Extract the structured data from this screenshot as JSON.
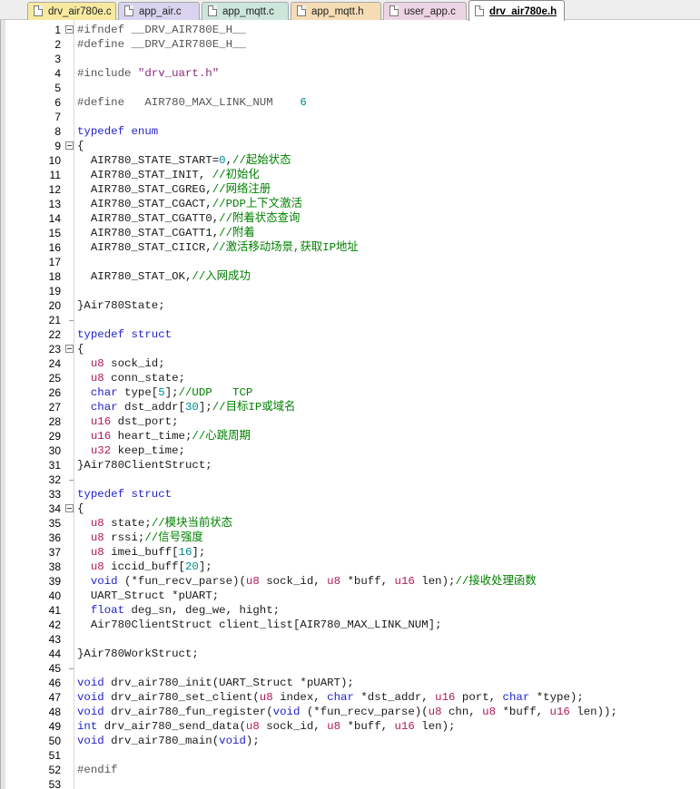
{
  "tabs": [
    {
      "label": "drv_air780e.c",
      "bg": "#f7eaa0",
      "active": false
    },
    {
      "label": "app_air.c",
      "bg": "#d9d3f0",
      "active": false
    },
    {
      "label": "app_mqtt.c",
      "bg": "#cde6dc",
      "active": false
    },
    {
      "label": "app_mqtt.h",
      "bg": "#f5dcb4",
      "active": false
    },
    {
      "label": "user_app.c",
      "bg": "#ecd4e4",
      "active": false
    },
    {
      "label": "drv_air780e.h",
      "bg": "#ffffff",
      "active": true
    }
  ],
  "editor": {
    "colors": {
      "keyword": "#2222cc",
      "type": "#b01a5a",
      "comment": "#008000",
      "string": "#8a2a7a",
      "number": "#008a8a",
      "preprocessor": "#555555"
    },
    "lines": [
      {
        "n": "1",
        "fold": "open",
        "tokens": [
          [
            "pp",
            "#ifndef __DRV_AIR780E_H__"
          ]
        ]
      },
      {
        "n": "2",
        "fold": "",
        "tokens": [
          [
            "pp",
            "#define __DRV_AIR780E_H__"
          ]
        ]
      },
      {
        "n": "3",
        "fold": "",
        "tokens": []
      },
      {
        "n": "4",
        "fold": "",
        "tokens": [
          [
            "pp",
            "#include "
          ],
          [
            "str",
            "\"drv_uart.h\""
          ]
        ]
      },
      {
        "n": "5",
        "fold": "",
        "tokens": []
      },
      {
        "n": "6",
        "fold": "",
        "tokens": [
          [
            "pp",
            "#define   AIR780_MAX_LINK_NUM    "
          ],
          [
            "num",
            "6"
          ]
        ]
      },
      {
        "n": "7",
        "fold": "",
        "tokens": []
      },
      {
        "n": "8",
        "fold": "",
        "tokens": [
          [
            "kw",
            "typedef enum"
          ]
        ]
      },
      {
        "n": "9",
        "fold": "open",
        "tokens": [
          [
            "pl",
            "{"
          ]
        ]
      },
      {
        "n": "10",
        "fold": "",
        "tokens": [
          [
            "pl",
            "  AIR780_STATE_START="
          ],
          [
            "num",
            "0"
          ],
          [
            "pl",
            ","
          ],
          [
            "cm",
            "//起始状态"
          ]
        ]
      },
      {
        "n": "11",
        "fold": "",
        "tokens": [
          [
            "pl",
            "  AIR780_STAT_INIT, "
          ],
          [
            "cm",
            "//初始化"
          ]
        ]
      },
      {
        "n": "12",
        "fold": "",
        "tokens": [
          [
            "pl",
            "  AIR780_STAT_CGREG,"
          ],
          [
            "cm",
            "//网络注册"
          ]
        ]
      },
      {
        "n": "13",
        "fold": "",
        "tokens": [
          [
            "pl",
            "  AIR780_STAT_CGACT,"
          ],
          [
            "cm",
            "//PDP上下文激活"
          ]
        ]
      },
      {
        "n": "14",
        "fold": "",
        "tokens": [
          [
            "pl",
            "  AIR780_STAT_CGATT0,"
          ],
          [
            "cm",
            "//附着状态查询"
          ]
        ]
      },
      {
        "n": "15",
        "fold": "",
        "tokens": [
          [
            "pl",
            "  AIR780_STAT_CGATT1,"
          ],
          [
            "cm",
            "//附着"
          ]
        ]
      },
      {
        "n": "16",
        "fold": "",
        "tokens": [
          [
            "pl",
            "  AIR780_STAT_CIICR,"
          ],
          [
            "cm",
            "//激活移动场景,获取IP地址"
          ]
        ]
      },
      {
        "n": "17",
        "fold": "",
        "tokens": []
      },
      {
        "n": "18",
        "fold": "",
        "tokens": [
          [
            "pl",
            "  AIR780_STAT_OK,"
          ],
          [
            "cm",
            "//入网成功"
          ]
        ]
      },
      {
        "n": "19",
        "fold": "",
        "tokens": []
      },
      {
        "n": "20",
        "fold": "",
        "tokens": [
          [
            "pl",
            "}Air780State;"
          ]
        ]
      },
      {
        "n": "21",
        "fold": "end",
        "tokens": []
      },
      {
        "n": "22",
        "fold": "",
        "tokens": [
          [
            "kw",
            "typedef struct"
          ]
        ]
      },
      {
        "n": "23",
        "fold": "open",
        "tokens": [
          [
            "pl",
            "{"
          ]
        ]
      },
      {
        "n": "24",
        "fold": "",
        "tokens": [
          [
            "pl",
            "  "
          ],
          [
            "ty",
            "u8"
          ],
          [
            "pl",
            " sock_id;"
          ]
        ]
      },
      {
        "n": "25",
        "fold": "",
        "tokens": [
          [
            "pl",
            "  "
          ],
          [
            "ty",
            "u8"
          ],
          [
            "pl",
            " conn_state;"
          ]
        ]
      },
      {
        "n": "26",
        "fold": "",
        "tokens": [
          [
            "pl",
            "  "
          ],
          [
            "kw",
            "char"
          ],
          [
            "pl",
            " type["
          ],
          [
            "num",
            "5"
          ],
          [
            "pl",
            "];"
          ],
          [
            "cm",
            "//UDP   TCP"
          ]
        ]
      },
      {
        "n": "27",
        "fold": "",
        "tokens": [
          [
            "pl",
            "  "
          ],
          [
            "kw",
            "char"
          ],
          [
            "pl",
            " dst_addr["
          ],
          [
            "num",
            "30"
          ],
          [
            "pl",
            "];"
          ],
          [
            "cm",
            "//目标IP或域名"
          ]
        ]
      },
      {
        "n": "28",
        "fold": "",
        "tokens": [
          [
            "pl",
            "  "
          ],
          [
            "ty",
            "u16"
          ],
          [
            "pl",
            " dst_port;"
          ]
        ]
      },
      {
        "n": "29",
        "fold": "",
        "tokens": [
          [
            "pl",
            "  "
          ],
          [
            "ty",
            "u16"
          ],
          [
            "pl",
            " heart_time;"
          ],
          [
            "cm",
            "//心跳周期"
          ]
        ]
      },
      {
        "n": "30",
        "fold": "",
        "tokens": [
          [
            "pl",
            "  "
          ],
          [
            "ty",
            "u32"
          ],
          [
            "pl",
            " keep_time;"
          ]
        ]
      },
      {
        "n": "31",
        "fold": "",
        "tokens": [
          [
            "pl",
            "}Air780ClientStruct;"
          ]
        ]
      },
      {
        "n": "32",
        "fold": "end",
        "tokens": []
      },
      {
        "n": "33",
        "fold": "",
        "tokens": [
          [
            "kw",
            "typedef struct"
          ]
        ]
      },
      {
        "n": "34",
        "fold": "open",
        "tokens": [
          [
            "pl",
            "{"
          ]
        ]
      },
      {
        "n": "35",
        "fold": "",
        "tokens": [
          [
            "pl",
            "  "
          ],
          [
            "ty",
            "u8"
          ],
          [
            "pl",
            " state;"
          ],
          [
            "cm",
            "//模块当前状态"
          ]
        ]
      },
      {
        "n": "36",
        "fold": "",
        "tokens": [
          [
            "pl",
            "  "
          ],
          [
            "ty",
            "u8"
          ],
          [
            "pl",
            " rssi;"
          ],
          [
            "cm",
            "//信号强度"
          ]
        ]
      },
      {
        "n": "37",
        "fold": "",
        "tokens": [
          [
            "pl",
            "  "
          ],
          [
            "ty",
            "u8"
          ],
          [
            "pl",
            " imei_buff["
          ],
          [
            "num",
            "16"
          ],
          [
            "pl",
            "];"
          ]
        ]
      },
      {
        "n": "38",
        "fold": "",
        "tokens": [
          [
            "pl",
            "  "
          ],
          [
            "ty",
            "u8"
          ],
          [
            "pl",
            " iccid_buff["
          ],
          [
            "num",
            "20"
          ],
          [
            "pl",
            "];"
          ]
        ]
      },
      {
        "n": "39",
        "fold": "",
        "tokens": [
          [
            "pl",
            "  "
          ],
          [
            "kw",
            "void"
          ],
          [
            "pl",
            " (*fun_recv_parse)("
          ],
          [
            "ty",
            "u8"
          ],
          [
            "pl",
            " sock_id, "
          ],
          [
            "ty",
            "u8"
          ],
          [
            "pl",
            " *buff, "
          ],
          [
            "ty",
            "u16"
          ],
          [
            "pl",
            " len);"
          ],
          [
            "cm",
            "//接收处理函数"
          ]
        ]
      },
      {
        "n": "40",
        "fold": "",
        "tokens": [
          [
            "pl",
            "  UART_Struct *pUART;"
          ]
        ]
      },
      {
        "n": "41",
        "fold": "",
        "tokens": [
          [
            "pl",
            "  "
          ],
          [
            "kw",
            "float"
          ],
          [
            "pl",
            " deg_sn, deg_we, hight;"
          ]
        ]
      },
      {
        "n": "42",
        "fold": "",
        "tokens": [
          [
            "pl",
            "  Air780ClientStruct client_list[AIR780_MAX_LINK_NUM];"
          ]
        ]
      },
      {
        "n": "43",
        "fold": "",
        "tokens": []
      },
      {
        "n": "44",
        "fold": "",
        "tokens": [
          [
            "pl",
            "}Air780WorkStruct;"
          ]
        ]
      },
      {
        "n": "45",
        "fold": "end",
        "tokens": []
      },
      {
        "n": "46",
        "fold": "",
        "tokens": [
          [
            "kw",
            "void"
          ],
          [
            "pl",
            " drv_air780_init(UART_Struct *pUART);"
          ]
        ]
      },
      {
        "n": "47",
        "fold": "",
        "tokens": [
          [
            "kw",
            "void"
          ],
          [
            "pl",
            " drv_air780_set_client("
          ],
          [
            "ty",
            "u8"
          ],
          [
            "pl",
            " index, "
          ],
          [
            "kw",
            "char"
          ],
          [
            "pl",
            " *dst_addr, "
          ],
          [
            "ty",
            "u16"
          ],
          [
            "pl",
            " port, "
          ],
          [
            "kw",
            "char"
          ],
          [
            "pl",
            " *type);"
          ]
        ]
      },
      {
        "n": "48",
        "fold": "",
        "tokens": [
          [
            "kw",
            "void"
          ],
          [
            "pl",
            " drv_air780_fun_register("
          ],
          [
            "kw",
            "void"
          ],
          [
            "pl",
            " (*fun_recv_parse)("
          ],
          [
            "ty",
            "u8"
          ],
          [
            "pl",
            " chn, "
          ],
          [
            "ty",
            "u8"
          ],
          [
            "pl",
            " *buff, "
          ],
          [
            "ty",
            "u16"
          ],
          [
            "pl",
            " len));"
          ]
        ]
      },
      {
        "n": "49",
        "fold": "",
        "tokens": [
          [
            "kw",
            "int"
          ],
          [
            "pl",
            " drv_air780_send_data("
          ],
          [
            "ty",
            "u8"
          ],
          [
            "pl",
            " sock_id, "
          ],
          [
            "ty",
            "u8"
          ],
          [
            "pl",
            " *buff, "
          ],
          [
            "ty",
            "u16"
          ],
          [
            "pl",
            " len);"
          ]
        ]
      },
      {
        "n": "50",
        "fold": "",
        "tokens": [
          [
            "kw",
            "void"
          ],
          [
            "pl",
            " drv_air780_main("
          ],
          [
            "kw",
            "void"
          ],
          [
            "pl",
            ");"
          ]
        ]
      },
      {
        "n": "51",
        "fold": "",
        "tokens": []
      },
      {
        "n": "52",
        "fold": "",
        "tokens": [
          [
            "pp",
            "#endif"
          ]
        ]
      },
      {
        "n": "53",
        "fold": "",
        "tokens": []
      }
    ]
  }
}
